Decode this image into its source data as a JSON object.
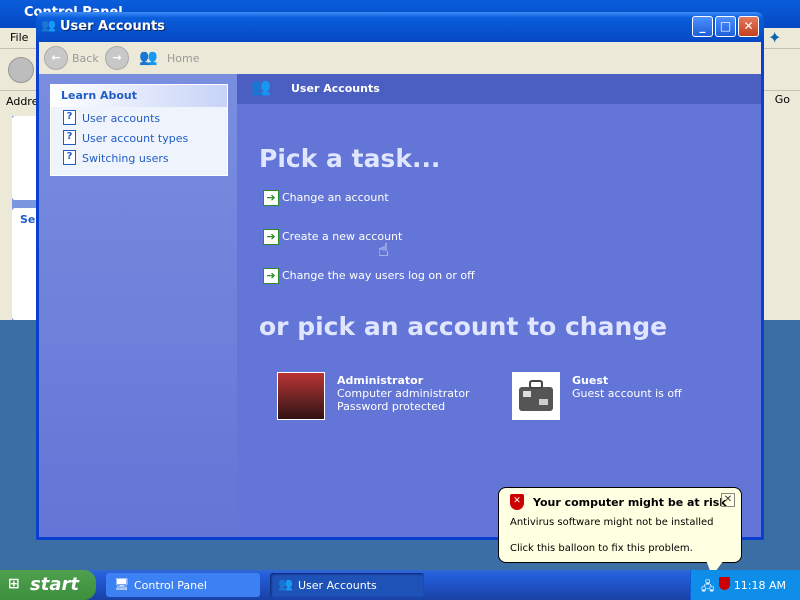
{
  "background_window": {
    "title": "Control Panel",
    "menu": "File",
    "address_label": "Addre",
    "go_label": "Go",
    "panel_letter": "Se"
  },
  "window": {
    "title": "User Accounts",
    "toolbar": {
      "back": "Back",
      "home": "Home"
    }
  },
  "sidebar": {
    "heading": "Learn About",
    "items": [
      {
        "label": "User accounts"
      },
      {
        "label": "User account types"
      },
      {
        "label": "Switching users"
      }
    ]
  },
  "main": {
    "header": "User Accounts",
    "pick_task": "Pick a task...",
    "tasks": [
      {
        "label": "Change an account"
      },
      {
        "label": "Create a new account"
      },
      {
        "label": "Change the way users log on or off"
      }
    ],
    "pick_account": "or pick an account to change",
    "accounts": [
      {
        "name": "Administrator",
        "line1": "Computer administrator",
        "line2": "Password protected"
      },
      {
        "name": "Guest",
        "line1": "Guest account is off",
        "line2": ""
      }
    ]
  },
  "balloon": {
    "title": "Your computer might be at risk",
    "line1": "Antivirus software might not be installed",
    "line2": "Click this balloon to fix this problem."
  },
  "taskbar": {
    "start": "start",
    "items": [
      {
        "label": "Control Panel"
      },
      {
        "label": "User Accounts"
      }
    ],
    "clock": "11:18 AM"
  }
}
